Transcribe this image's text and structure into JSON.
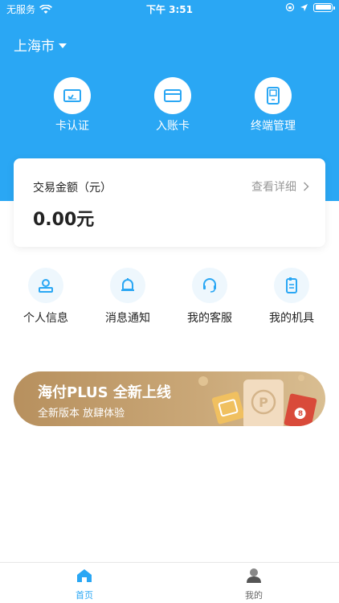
{
  "status_bar": {
    "carrier": "无服务",
    "time": "下午 3:51"
  },
  "header": {
    "city": "上海市"
  },
  "top_actions": [
    {
      "label": "卡认证",
      "icon": "card-verify-icon"
    },
    {
      "label": "入账卡",
      "icon": "bank-card-icon"
    },
    {
      "label": "终端管理",
      "icon": "terminal-icon"
    }
  ],
  "amount_card": {
    "title": "交易金额（元）",
    "detail_link": "查看详细",
    "value": "0.00",
    "unit": "元"
  },
  "quick_items": [
    {
      "label": "个人信息",
      "icon": "person-icon"
    },
    {
      "label": "消息通知",
      "icon": "bell-icon"
    },
    {
      "label": "我的客服",
      "icon": "headset-icon"
    },
    {
      "label": "我的机具",
      "icon": "device-icon"
    }
  ],
  "banner": {
    "title": "海付PLUS 全新上线",
    "subtitle": "全新版本 放肆体验",
    "badge_number": "8"
  },
  "tabbar": {
    "home": "首页",
    "mine": "我的"
  },
  "colors": {
    "primary": "#2aa7f4",
    "banner_gold": "#c29e6c",
    "icon_blue": "#2aa7f4"
  }
}
